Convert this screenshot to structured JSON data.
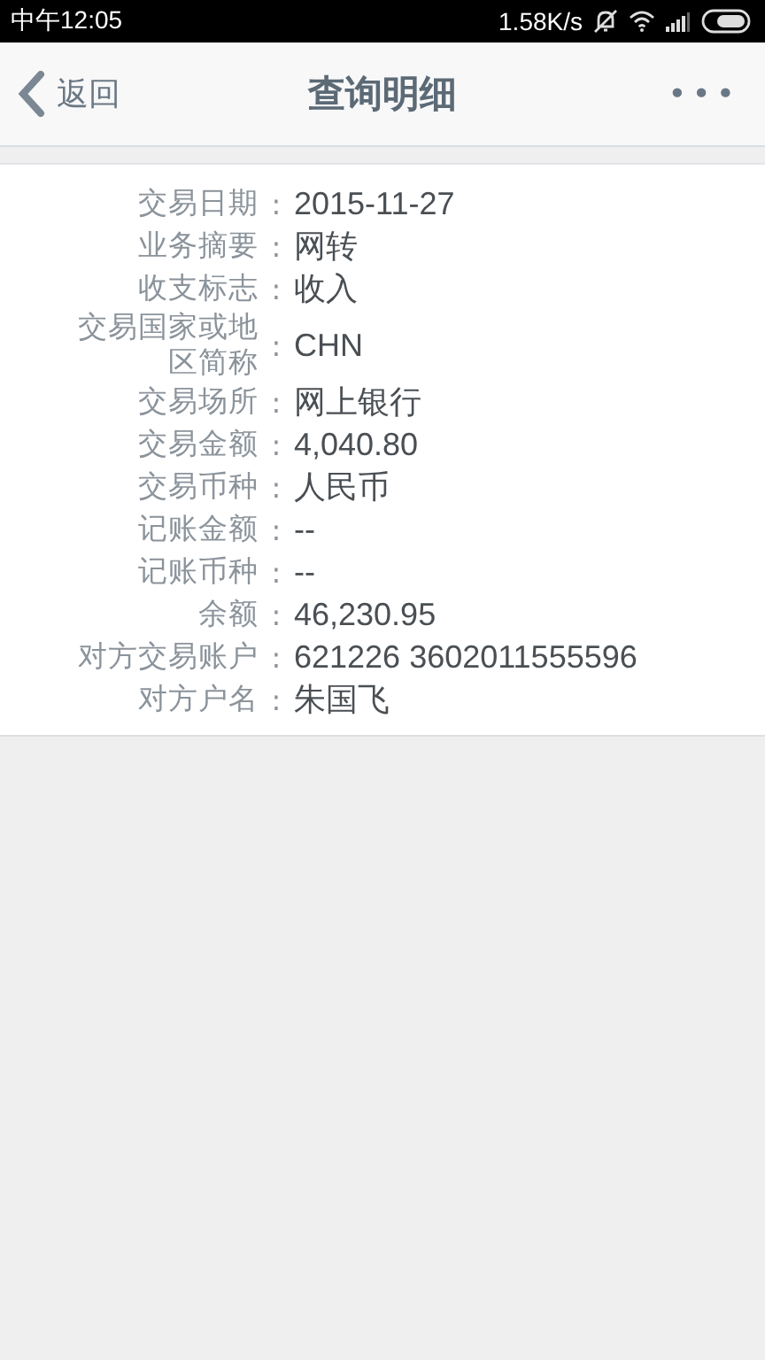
{
  "status_bar": {
    "time": "中午12:05",
    "speed": "1.58K/s"
  },
  "nav": {
    "back": "返回",
    "title": "查询明细",
    "more": "•••"
  },
  "details": [
    {
      "label": "交易日期",
      "separator": ":",
      "value": "2015-11-27"
    },
    {
      "label": "业务摘要",
      "separator": ":",
      "value": "网转"
    },
    {
      "label": "收支标志",
      "separator": ":",
      "value": "收入"
    },
    {
      "label": "交易国家或地区简称",
      "separator": ":",
      "value": "CHN"
    },
    {
      "label": "交易场所",
      "separator": ":",
      "value": "网上银行"
    },
    {
      "label": "交易金额",
      "separator": ":",
      "value": "4,040.80"
    },
    {
      "label": "交易币种",
      "separator": ":",
      "value": "人民币"
    },
    {
      "label": "记账金额",
      "separator": ":",
      "value": "--"
    },
    {
      "label": "记账币种",
      "separator": ":",
      "value": "--"
    },
    {
      "label": "余额",
      "separator": ":",
      "value": "46,230.95"
    },
    {
      "label": "对方交易账户",
      "separator": ":",
      "value": "621226 3602011555596"
    },
    {
      "label": "对方户名",
      "separator": ":",
      "value": "朱国飞"
    }
  ]
}
